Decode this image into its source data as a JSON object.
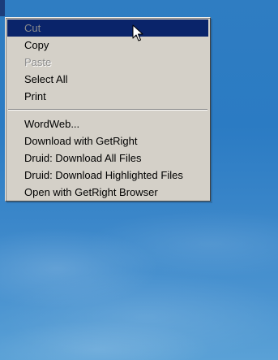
{
  "menu": {
    "items_group1": [
      {
        "label": "Cut",
        "state": "disabled-highlighted"
      },
      {
        "label": "Copy",
        "state": "enabled"
      },
      {
        "label": "Paste",
        "state": "disabled"
      },
      {
        "label": "Select All",
        "state": "enabled"
      },
      {
        "label": "Print",
        "state": "enabled"
      }
    ],
    "items_group2": [
      {
        "label": "WordWeb...",
        "state": "enabled"
      },
      {
        "label": "Download with GetRight",
        "state": "enabled"
      },
      {
        "label": "Druid: Download All Files",
        "state": "enabled"
      },
      {
        "label": "Druid: Download Highlighted Files",
        "state": "enabled"
      },
      {
        "label": "Open with GetRight Browser",
        "state": "enabled"
      }
    ]
  },
  "cursor": {
    "icon": "arrow-pointer-icon"
  },
  "colors": {
    "menu_background": "#d4d0c8",
    "highlight": "#0a246a",
    "disabled_text": "#8c8c8c",
    "desktop_blue": "#2b7bc3"
  }
}
